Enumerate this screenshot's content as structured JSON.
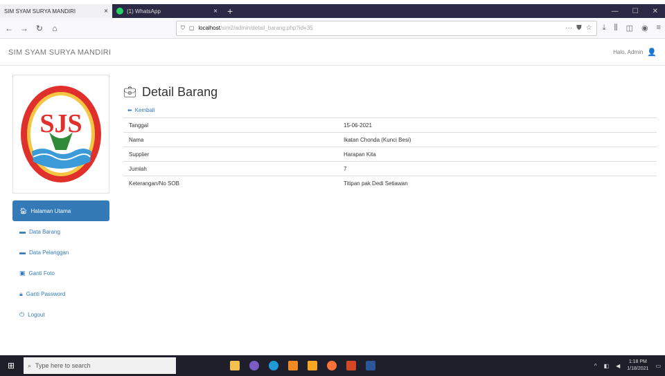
{
  "browser": {
    "tabs": [
      {
        "title": "SIM SYAM SURYA MANDIRI",
        "close": "×"
      },
      {
        "title": "(1) WhatsApp",
        "close": "×"
      }
    ],
    "new_tab": "+",
    "url_host": "localhost",
    "url_path": "/sim2/admin/detail_barang.php?id=35",
    "url_more": "···"
  },
  "app": {
    "brand": "SIM SYAM SURYA MANDIRI",
    "user_greeting": "Halo, Admin"
  },
  "sidebar": {
    "logo_text": "SJS",
    "items": [
      {
        "label": "Halaman Utama",
        "active": true
      },
      {
        "label": "Data Barang",
        "active": false
      },
      {
        "label": "Data Pelanggan",
        "active": false
      },
      {
        "label": "Ganti Foto",
        "active": false
      },
      {
        "label": "Ganti Password",
        "active": false
      },
      {
        "label": "Logout",
        "active": false
      }
    ]
  },
  "main": {
    "title": "Detail Barang",
    "back_label": "Kembali",
    "rows": [
      {
        "key": "Tanggal",
        "value": "15-06-2021"
      },
      {
        "key": "Nama",
        "value": "Ikatan Chonda (Kunci Besi)"
      },
      {
        "key": "Supplier",
        "value": "Harapan Kita"
      },
      {
        "key": "Jumlah",
        "value": "7"
      },
      {
        "key": "Keterangan/No SOB",
        "value": "Titipan pak Dedi Setiawan"
      }
    ]
  },
  "taskbar": {
    "search_placeholder": "Type here to search",
    "time": "1:18 PM",
    "date": "1/18/2021"
  },
  "colors": {
    "accent": "#337ab7",
    "tabbar": "#2b2a45",
    "taskbar": "#1f1f2b"
  }
}
